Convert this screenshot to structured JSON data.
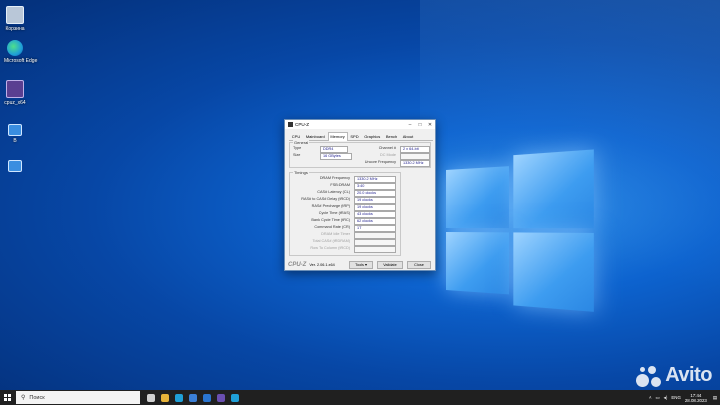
{
  "desktop": {
    "icons": [
      {
        "label": "Корзина",
        "icon": "recycle-bin-icon",
        "color": "#b9c7d8"
      },
      {
        "label": "Microsoft Edge",
        "icon": "edge-icon",
        "color": "#1fa0d8"
      },
      {
        "label": "cpuz_x64",
        "icon": "cpuz-icon",
        "color": "#5a3f91"
      },
      {
        "label": "В",
        "icon": "monitor-icon",
        "color": "#3a8ee0"
      },
      {
        "label": "",
        "icon": "monitor-icon",
        "color": "#3a8ee0"
      }
    ]
  },
  "window": {
    "title": "CPU-Z",
    "controls": {
      "minimize": "–",
      "maximize": "□",
      "close": "✕"
    },
    "tabs": [
      "CPU",
      "Mainboard",
      "Memory",
      "SPD",
      "Graphics",
      "Bench",
      "About"
    ],
    "active_tab": "Memory",
    "general": {
      "label": "General",
      "type_label": "Type",
      "type": "DDR4",
      "size_label": "Size",
      "size": "16 GBytes",
      "channel_label": "Channel #",
      "channel": "2 x 64-bit",
      "dc_label": "DC Mode",
      "dc": "",
      "uncore_label": "Uncore Frequency",
      "uncore": "1330.2 MHz"
    },
    "timings": {
      "label": "Timings",
      "rows": [
        {
          "label": "DRAM Frequency",
          "value": "1330.2 MHz",
          "enabled": true
        },
        {
          "label": "FSB:DRAM",
          "value": "3:40",
          "enabled": true
        },
        {
          "label": "CAS# Latency (CL)",
          "value": "20.0 clocks",
          "enabled": true
        },
        {
          "label": "RAS# to CAS# Delay (tRCD)",
          "value": "19 clocks",
          "enabled": true
        },
        {
          "label": "RAS# Precharge (tRP)",
          "value": "19 clocks",
          "enabled": true
        },
        {
          "label": "Cycle Time (tRAS)",
          "value": "43 clocks",
          "enabled": true
        },
        {
          "label": "Bank Cycle Time (tRC)",
          "value": "62 clocks",
          "enabled": true
        },
        {
          "label": "Command Rate (CR)",
          "value": "1T",
          "enabled": true
        },
        {
          "label": "DRAM Idle Timer",
          "value": "",
          "enabled": false
        },
        {
          "label": "Total CAS# (tRDRAM)",
          "value": "",
          "enabled": false
        },
        {
          "label": "Row To Column (tRCD)",
          "value": "",
          "enabled": false
        }
      ]
    },
    "footer": {
      "brand": "CPU-Z",
      "version": "Ver. 2.06.1.x64",
      "tools": "Tools",
      "validate": "Validate",
      "close": "Close"
    }
  },
  "taskbar": {
    "search_placeholder": "Поиск",
    "apps": [
      {
        "icon": "task-view-icon",
        "color": "#d0d0d0"
      },
      {
        "icon": "file-explorer-icon",
        "color": "#e8b43a"
      },
      {
        "icon": "edge-icon",
        "color": "#1fa0d8"
      },
      {
        "icon": "store-icon",
        "color": "#3b7fd6"
      },
      {
        "icon": "mail-icon",
        "color": "#2a75d0"
      },
      {
        "icon": "cpuz-icon",
        "color": "#6a4fb0"
      },
      {
        "icon": "edge-icon",
        "color": "#1fa0d8"
      }
    ],
    "language": "ENG",
    "time": "17:44",
    "date": "28.08.2023"
  },
  "watermark": {
    "text": "Avito"
  }
}
